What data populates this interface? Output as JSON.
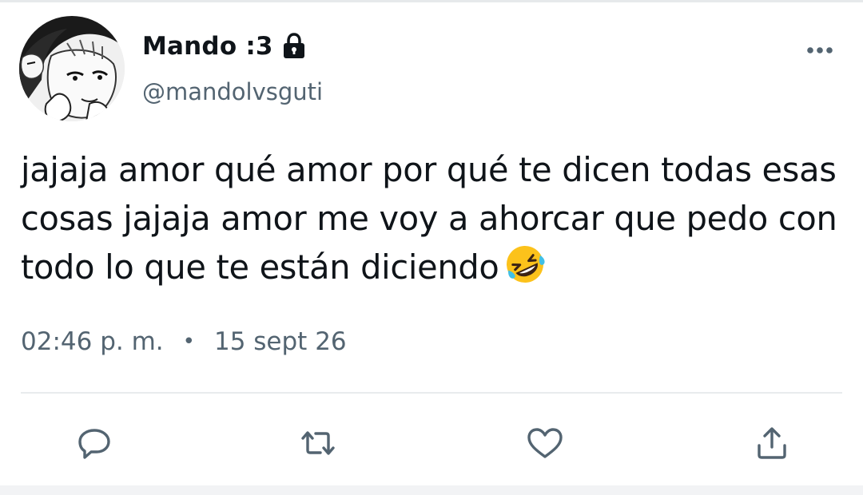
{
  "tweet": {
    "author": {
      "display_name": "Mando :3",
      "handle": "@mandolvsguti",
      "protected_icon": "lock-icon"
    },
    "text": "jajaja amor qué amor por qué te dicen todas esas cosas jajaja amor me voy a ahorcar que pedo con todo lo que te están diciendo",
    "emoji": "rolling-on-the-floor-laughing-emoji",
    "time": "02:46 p. m.",
    "separator": "•",
    "date": "15 sept 26"
  },
  "actions": [
    {
      "name": "reply",
      "icon": "reply-icon"
    },
    {
      "name": "retweet",
      "icon": "retweet-icon"
    },
    {
      "name": "like",
      "icon": "heart-icon"
    },
    {
      "name": "share",
      "icon": "share-icon"
    }
  ],
  "colors": {
    "text_primary": "#0f1419",
    "text_secondary": "#536471",
    "icon": "#536471",
    "divider": "#e8ebed"
  }
}
